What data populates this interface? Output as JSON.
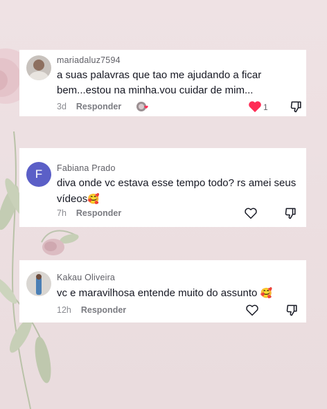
{
  "comments": [
    {
      "username": "mariadaluz7594",
      "text": "a suas palavras que tao me ajudando a ficar bem...estou na minha.vou cuidar de mim...",
      "age": "3d",
      "reply_label": "Responder",
      "likes": "1",
      "liked": true,
      "avatar": "photo-avatar"
    },
    {
      "username": "Fabiana Prado",
      "text": "diva onde vc estava esse tempo todo? rs amei seus vídeos",
      "emoji": "🥰",
      "age": "7h",
      "reply_label": "Responder",
      "avatar_letter": "F",
      "avatar_color": "#5b5fc7",
      "liked": false
    },
    {
      "username": "Kakau Oliveira",
      "text": "vc e maravilhosa entende muito do assunto",
      "emoji": "🥰",
      "age": "12h",
      "reply_label": "Responder",
      "avatar": "photo-avatar",
      "liked": false
    }
  ],
  "colors": {
    "like_red": "#fe2c55",
    "background": "#eddfe1"
  }
}
